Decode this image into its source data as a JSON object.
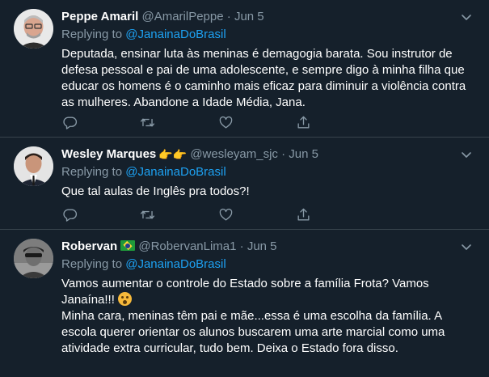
{
  "tweets": [
    {
      "name": "Peppe Amaril",
      "handle": "@AmarilPeppe",
      "separator": "·",
      "date": "Jun 5",
      "replying_prefix": "Replying to ",
      "replying_to": "@JanainaDoBrasil",
      "text": "Deputada, ensinar luta às meninas é demagogia barata. Sou instrutor de defesa pessoal e pai de uma adolescente, e sempre digo à minha filha que educar os homens é o caminho mais eficaz para diminuir a violência contra as mulheres. Abandone a Idade Média, Jana."
    },
    {
      "name": "Wesley Marques",
      "name_emoji": "👉👉",
      "handle": "@wesleyam_sjc",
      "separator": "·",
      "date": "Jun 5",
      "replying_prefix": "Replying to ",
      "replying_to": "@JanainaDoBrasil",
      "text": "Que tal aulas de Inglês pra todos?!"
    },
    {
      "name": "Robervan",
      "name_flag": "brazil-flag",
      "handle": "@RobervanLima1",
      "separator": "·",
      "date": "Jun 5",
      "replying_prefix": "Replying to ",
      "replying_to": "@JanainaDoBrasil",
      "text_part1": "Vamos aumentar o controle do Estado sobre a família Frota? Vamos Janaína!!! ",
      "text_part2": "\nMinha cara, meninas têm pai e mãe...essa é uma escolha da família. A escola querer orientar os alunos buscarem uma arte marcial como uma atividade extra curricular, tudo bem. Deixa o Estado fora disso."
    }
  ],
  "icons": {
    "reply": "reply-icon",
    "retweet": "retweet-icon",
    "like": "heart-icon",
    "share": "share-icon",
    "more": "chevron-down-icon"
  },
  "colors": {
    "background": "#15202b",
    "divider": "#38444d",
    "text": "#ffffff",
    "muted": "#8899a6",
    "link": "#1da1f2"
  }
}
